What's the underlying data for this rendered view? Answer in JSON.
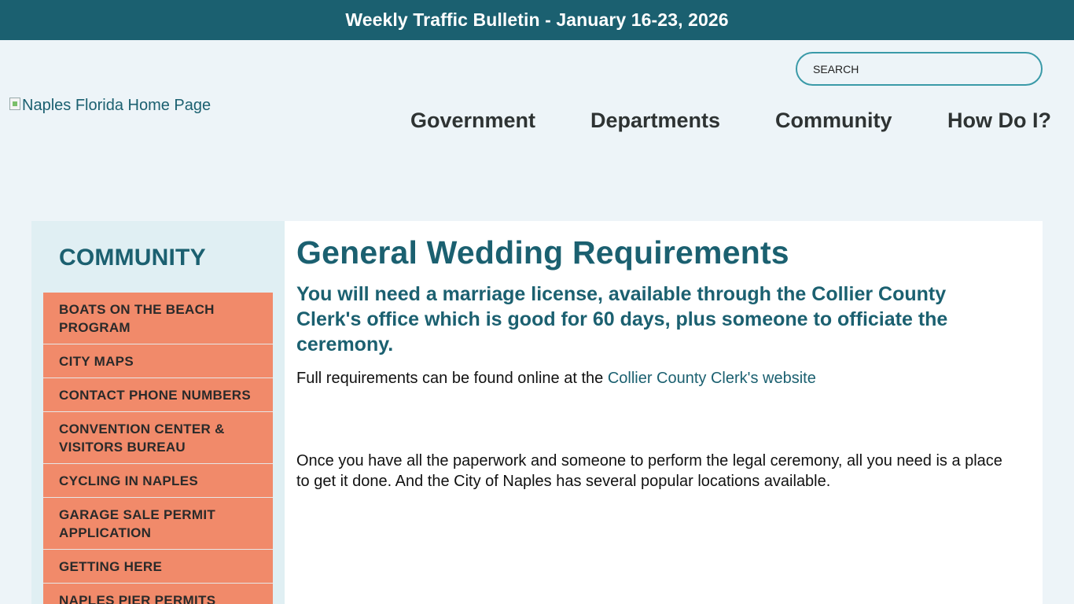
{
  "bulletin": {
    "text": "Weekly Traffic Bulletin - January 16-23, 2026"
  },
  "search": {
    "placeholder": "SEARCH"
  },
  "logo": {
    "alt_text": "Naples Florida Home Page"
  },
  "nav": {
    "items": [
      {
        "label": "Government"
      },
      {
        "label": "Departments"
      },
      {
        "label": "Community"
      },
      {
        "label": "How Do I?"
      }
    ]
  },
  "sidebar": {
    "title": "COMMUNITY",
    "items": [
      {
        "label": "BOATS ON THE BEACH PROGRAM"
      },
      {
        "label": "CITY MAPS"
      },
      {
        "label": "CONTACT PHONE NUMBERS"
      },
      {
        "label": "CONVENTION CENTER & VISITORS BUREAU"
      },
      {
        "label": "CYCLING IN NAPLES"
      },
      {
        "label": "GARAGE SALE PERMIT APPLICATION"
      },
      {
        "label": "GETTING HERE"
      },
      {
        "label": "NAPLES PIER PERMITS"
      }
    ]
  },
  "content": {
    "title": "General Wedding Requirements",
    "subhead": "You will need a marriage license, available through the Collier County Clerk's office which is good for 60 days, plus someone to officiate the ceremony.",
    "para1_text": "Full requirements can be found online at the ",
    "para1_link": "Collier County Clerk's website",
    "para2": "Once you have all the paperwork and someone to perform the legal ceremony, all you need is a place to get it done.  And the City of Naples has several popular locations available."
  },
  "colors": {
    "brand_teal": "#1b6070",
    "page_bg": "#edf4f8",
    "sidebar_bg": "#e0eff3",
    "sidebar_item_bg": "#f18a6a",
    "search_border": "#3a9aa8"
  }
}
